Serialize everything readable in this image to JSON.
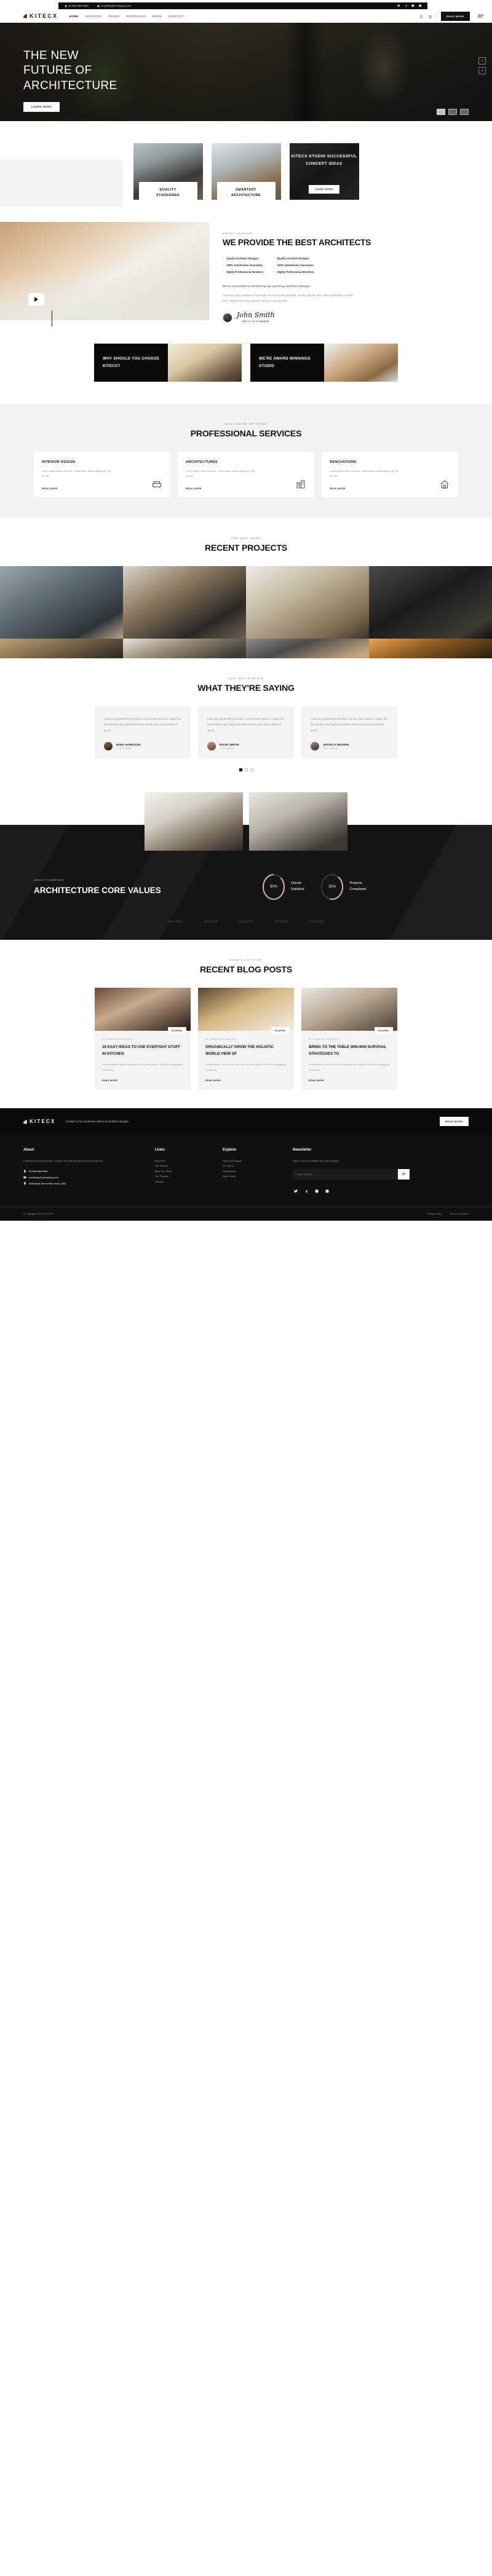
{
  "topbar": {
    "phone": "92 666 888 0000",
    "email": "needhelp@company.com",
    "socials": [
      "twitter-icon",
      "facebook-icon",
      "dribbble-icon",
      "instagram-icon"
    ]
  },
  "nav": {
    "brand": "KITECX",
    "items": [
      {
        "label": "HOME",
        "active": true
      },
      {
        "label": "SERVICES",
        "active": false
      },
      {
        "label": "PAGES",
        "active": false
      },
      {
        "label": "PORTFOLIO",
        "active": false
      },
      {
        "label": "NEWS",
        "active": false
      },
      {
        "label": "CONTACT",
        "active": false
      }
    ],
    "cta": "READ MORE"
  },
  "hero": {
    "line1": "THE NEW",
    "line2": "FUTURE OF",
    "line3": "ARCHITECTURE",
    "button": "LEARN MORE"
  },
  "features": {
    "cards": [
      {
        "title": "QUALITY\nSTANDARDS"
      },
      {
        "title": "SMARTEST\nARCHITECTURE"
      }
    ],
    "promo": {
      "title": "KITECX STUDIO SUCCESSFUL CONCEPT IDEAS",
      "button": "LEARN MORE"
    }
  },
  "about": {
    "eyebrow": "ABOUT COMPANY",
    "heading": "WE PROVIDE THE BEST ARCHITECTS",
    "list_left": [
      "Quality Architect Designs",
      "100% Satisfaction Guarantee",
      "Highly Professional Members"
    ],
    "list_right": [
      "Quality Architect Designs",
      "100% Satisfaction Guarantee",
      "Highly Professional Members"
    ],
    "lead": "We're committed to delivering eye-catching architect designs",
    "paragraph": "There are many variations of passages of Lorem Ipsum available, but the majority have suffered alteration in some form, simply free text by injected humour, or randomised.",
    "signature_name": "John Smith",
    "signature_role": "CEO & CO FOUNDER"
  },
  "splits": [
    {
      "title": "WHY SHOULD YOU CHOOSE KITECS?"
    },
    {
      "title": "WE'RE AWARD WINNINGS STUDIO"
    }
  ],
  "services": {
    "eyebrow": "WHAT WE'RE OFFERING",
    "heading": "PROFESSIONAL SERVICES",
    "cards": [
      {
        "title": "INTERIOR DESIGN",
        "text": "Lorem ipsum dolor sit amet, consectetur notted adipisicing elit sed do.",
        "more": "READ MORE",
        "icon": "sofa-icon"
      },
      {
        "title": "ARCHITECTURES",
        "text": "Lorem ipsum dolor sit amet, consectetur notted adipisicing elit sed do.",
        "more": "READ MORE",
        "icon": "building-icon"
      },
      {
        "title": "RENOVATIONS",
        "text": "Lorem ipsum dolor sit amet, consectetur notted adipisicing elit sed do.",
        "more": "READ MORE",
        "icon": "house-icon"
      }
    ]
  },
  "projects": {
    "eyebrow": "OUR BEST WORK",
    "heading": "RECENT PROJECTS"
  },
  "testimonials": {
    "eyebrow": "OUR TESTIMONIALS",
    "heading": "WHAT THEY'RE SAYING",
    "cards": [
      {
        "quote": "I was very impresed by the kitecx service lorem ipsum is simply free text used by copy typing refreshing. Neque porro est qui dolorem ipsum.",
        "name": "MIKE HARDSON",
        "role": "CUSTOMER"
      },
      {
        "quote": "I was very impresed by the kitecx service lorem ipsum is simply free text used by copy typing refreshing. Neque porro est qui dolorem ipsum.",
        "name": "ROSE SMITH",
        "role": "CUSTOMER"
      },
      {
        "quote": "I was very impresed by the kitecx service lorem ipsum is simply free text used by copy typing refreshing. Neque porro est qui dolorem ipsum.",
        "name": "JESSICA BROWN",
        "role": "CUSTOMER"
      }
    ]
  },
  "core": {
    "eyebrow": "ABOUT COMPANY",
    "heading": "ARCHITECTURE CORE VALUES",
    "stats": [
      {
        "value": "90%",
        "label": "Clients Satisfied",
        "percent": 90
      },
      {
        "value": "50%",
        "label": "Projects Completed",
        "percent": 50
      }
    ],
    "brands": [
      "envato",
      "envato",
      "envato",
      "envato",
      "envato"
    ]
  },
  "blog": {
    "eyebrow": "NEWS & ARTICLES",
    "heading": "RECENT BLOG POSTS",
    "posts": [
      {
        "date": "26 APRIL",
        "meta": "BY ADMIN   NO COMMENTS",
        "title": "16 EASY IDEAS TO USE EVERYDAY STUFF IN KITCHEN",
        "excerpt": "Lorem ipsum is simply free text used by new pepsim lorem this copytyping refreshing.",
        "more": "READ MORE"
      },
      {
        "date": "26 APRIL",
        "meta": "BY ADMIN   NO COMMENTS",
        "title": "ORGANICALLY GROW THE HOLISTIC WORLD VIEW OF",
        "excerpt": "Lorem ipsum is simply free text used by new pepsim lorem this copytyping refreshing.",
        "more": "READ MORE"
      },
      {
        "date": "26 APRIL",
        "meta": "BY ADMIN   NO COMMENTS",
        "title": "BRING TO THE TABLE WIN-WIN SURVIVAL STRATEGIES TO",
        "excerpt": "Lorem ipsum is simply free text used by new pepsim lorem this copytyping refreshing.",
        "more": "READ MORE"
      }
    ]
  },
  "cta": {
    "brand": "KITECX",
    "text": "Contact us for modernize interior & architect designs.",
    "button": "READ MORE"
  },
  "footer": {
    "about": {
      "title": "About",
      "text": "Lorem ipsum dolor sit amet, consect etur adi pisicing elit sed do eiusmod.",
      "phone": "92 666 888 0000",
      "email": "needhelp@company.com",
      "address": "88 Brafyn Street New York, USA"
    },
    "links": {
      "title": "Links",
      "items": [
        "About Us",
        "Our Mission",
        "Meet Our Team",
        "Our Projects",
        "Contact"
      ]
    },
    "explore": {
      "title": "Explore",
      "items": [
        "Types of Designs",
        "Our Menu",
        "Latest News",
        "Help Center"
      ]
    },
    "newsletter": {
      "title": "Newsletter",
      "text": "Sign up now for weekly news and updates.",
      "placeholder": "Email address",
      "socials": [
        "twitter-icon",
        "facebook-icon",
        "pinterest-icon",
        "instagram-icon"
      ]
    },
    "copyright": "© Copyright 2022 by KITECX",
    "bottom_links": [
      "Privacy Policy",
      "Terms of Condition"
    ]
  },
  "colors": {
    "accent": "#111111",
    "dark": "#0a0a0a",
    "muted": "#9a9a9a",
    "panel": "#f2f2f2"
  }
}
